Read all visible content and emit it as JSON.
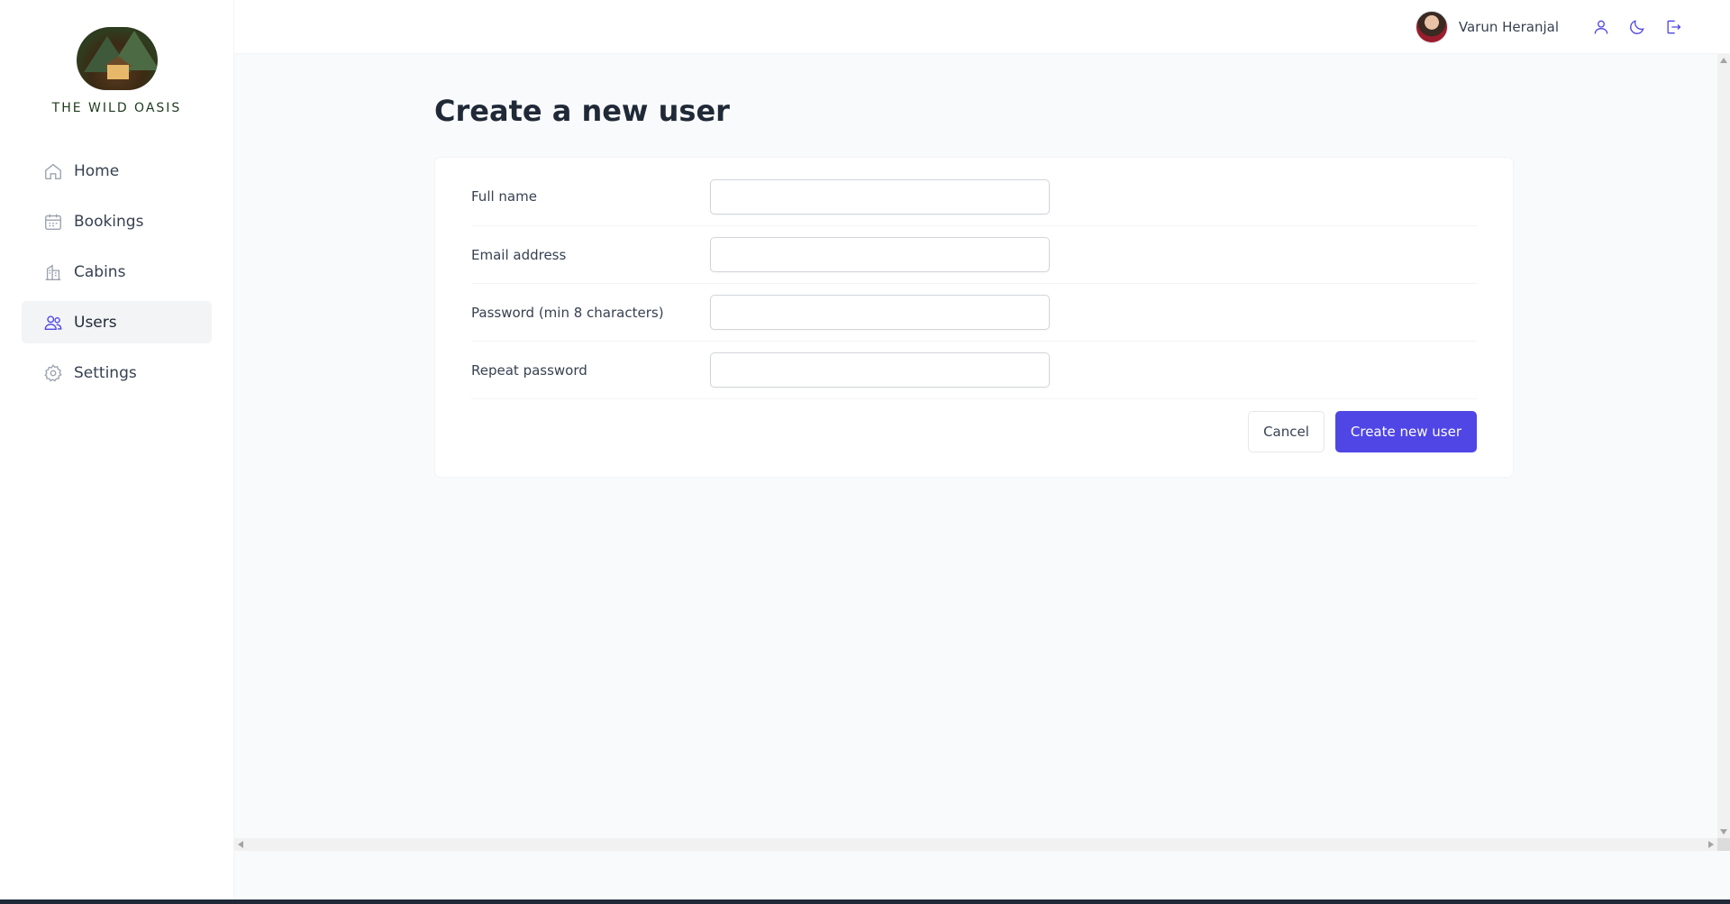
{
  "brand": {
    "name": "THE WILD OASIS"
  },
  "sidebar": {
    "items": [
      {
        "label": "Home",
        "icon": "home-icon"
      },
      {
        "label": "Bookings",
        "icon": "calendar-icon"
      },
      {
        "label": "Cabins",
        "icon": "cabins-icon"
      },
      {
        "label": "Users",
        "icon": "users-icon",
        "active": true
      },
      {
        "label": "Settings",
        "icon": "gear-icon"
      }
    ]
  },
  "header": {
    "user_name": "Varun Heranjal",
    "icons": [
      "user-icon",
      "moon-icon",
      "logout-icon"
    ],
    "accent_color": "#4f46e5"
  },
  "page": {
    "title": "Create a new user"
  },
  "form": {
    "fields": [
      {
        "label": "Full name",
        "value": "",
        "type": "text"
      },
      {
        "label": "Email address",
        "value": "",
        "type": "email"
      },
      {
        "label": "Password (min 8 characters)",
        "value": "",
        "type": "password"
      },
      {
        "label": "Repeat password",
        "value": "",
        "type": "password"
      }
    ],
    "cancel_label": "Cancel",
    "submit_label": "Create new user"
  }
}
